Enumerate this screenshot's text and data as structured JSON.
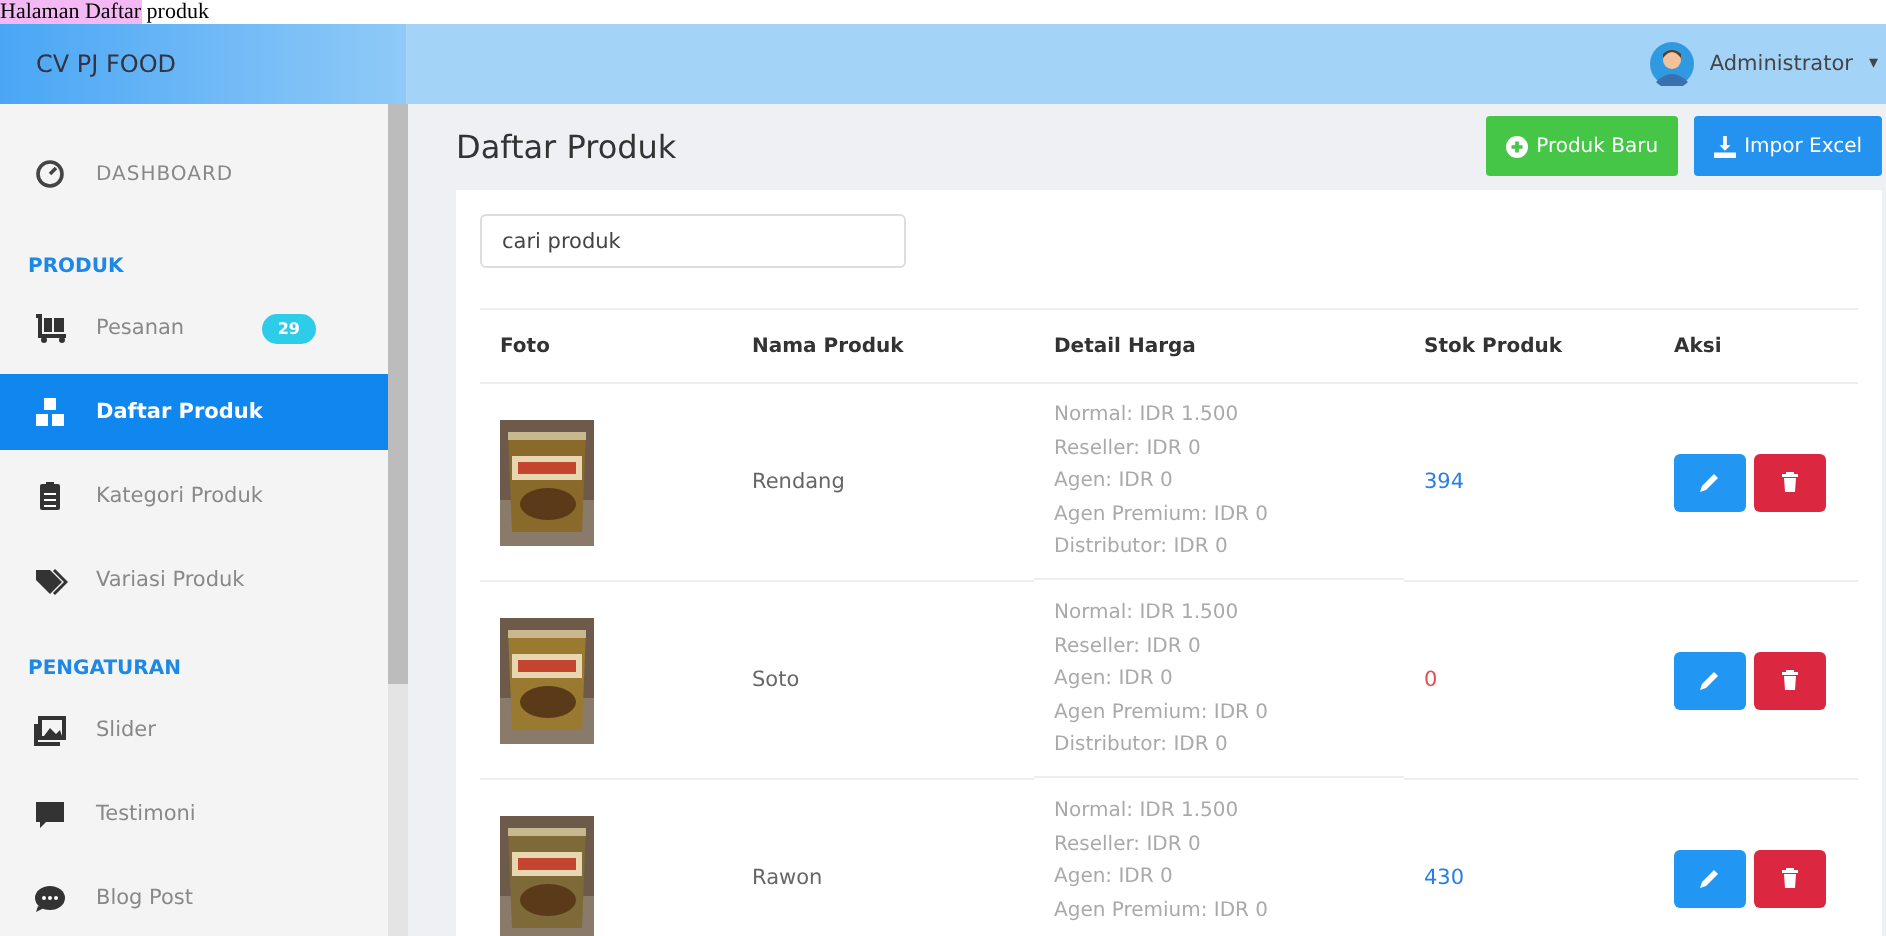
{
  "caption": {
    "highlight": "Halaman Daftar",
    "rest": "produk"
  },
  "brand": "CV PJ FOOD",
  "user": {
    "name": "Administrator",
    "caret": "▾"
  },
  "sidebar": {
    "sections": [
      {
        "items": [
          {
            "label": "DASHBOARD",
            "selected": false,
            "kind": "top"
          }
        ]
      },
      {
        "heading": "PRODUK",
        "items": [
          {
            "label": "Pesanan",
            "selected": false,
            "badge": "29"
          },
          {
            "label": "Daftar Produk",
            "selected": true
          },
          {
            "label": "Kategori Produk",
            "selected": false
          },
          {
            "label": "Variasi Produk",
            "selected": false
          }
        ]
      },
      {
        "heading": "PENGATURAN",
        "items": [
          {
            "label": "Slider",
            "selected": false
          },
          {
            "label": "Testimoni",
            "selected": false
          },
          {
            "label": "Blog Post",
            "selected": false
          }
        ]
      }
    ]
  },
  "page_title": "Daftar Produk",
  "actions": [
    {
      "label": "Produk Baru",
      "kind": "add"
    },
    {
      "label": "Impor Excel",
      "kind": "import"
    }
  ],
  "search": {
    "placeholder": "cari produk"
  },
  "table": {
    "columns": [
      "Foto",
      "Nama Produk",
      "Detail Harga",
      "Stok Produk",
      "Aksi"
    ],
    "rows": [
      {
        "photo": {
          "kind": "picture"
        },
        "name": "Rendang",
        "prices": [
          "Normal: IDR 1.500",
          "Reseller: IDR 0",
          "Agen: IDR 0",
          "Agen Premium: IDR 0",
          "Distributor: IDR 0"
        ],
        "stock": "394",
        "out_of_stock": false
      },
      {
        "photo": {
          "kind": "picture"
        },
        "name": "Soto",
        "prices": [
          "Normal: IDR 1.500",
          "Reseller: IDR 0",
          "Agen: IDR 0",
          "Agen Premium: IDR 0",
          "Distributor: IDR 0"
        ],
        "stock": "0",
        "out_of_stock": true
      },
      {
        "photo": {
          "kind": "picture"
        },
        "name": "Rawon",
        "prices": [
          "Normal: IDR 1.500",
          "Reseller: IDR 0",
          "Agen: IDR 0",
          "Agen Premium: IDR 0"
        ],
        "stock": "430",
        "out_of_stock": false
      }
    ]
  }
}
